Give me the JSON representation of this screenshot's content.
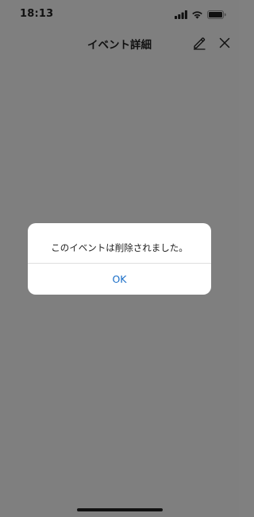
{
  "status_bar": {
    "time": "18:13",
    "icons": [
      "cellular-signal-icon",
      "wifi-icon",
      "battery-icon"
    ]
  },
  "header": {
    "title": "イベント詳細",
    "edit_icon": "pencil-icon",
    "close_icon": "close-icon"
  },
  "dialog": {
    "message": "このイベントは削除されました。",
    "ok_label": "OK"
  },
  "colors": {
    "overlay_background": "#7f7f7f",
    "dialog_background": "#ffffff",
    "accent": "#1a6ec8"
  }
}
